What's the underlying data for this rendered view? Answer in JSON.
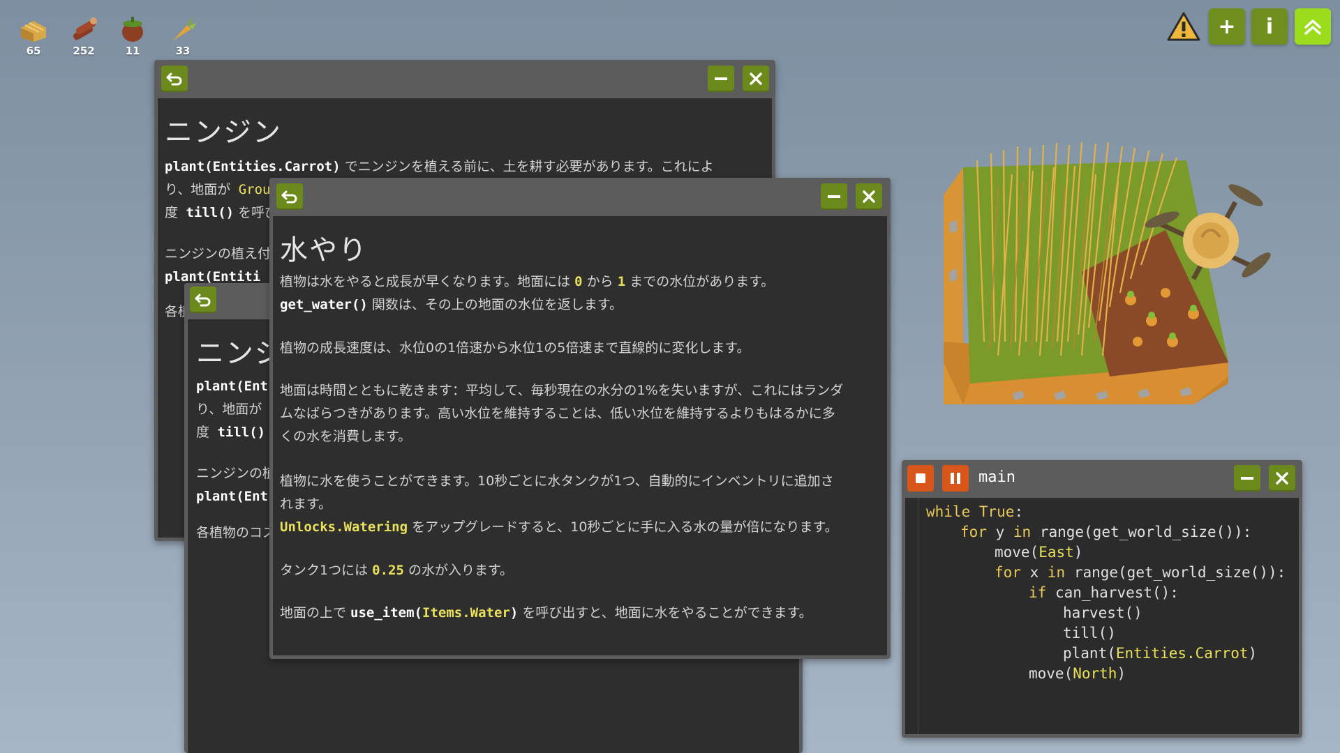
{
  "inventory": [
    {
      "name": "hay",
      "icon": "hay-icon",
      "count": "65"
    },
    {
      "name": "wood",
      "icon": "wood-icon",
      "count": "252"
    },
    {
      "name": "pumpkin",
      "icon": "pumpkin-icon",
      "count": "11"
    },
    {
      "name": "carrot",
      "icon": "carrot-icon",
      "count": "33"
    }
  ],
  "top_buttons": {
    "warning_icon": "warning-icon",
    "add_label": "+",
    "info_label": "i",
    "upgrade_icon": "double-chevron-up-icon"
  },
  "carrot_window": {
    "title": "ニンジン",
    "line1_code": "plant(Entities.Carrot)",
    "line1_text": " でニンジンを植える前に、土を耕す必要があります。これによ",
    "line2_text": "り、地面が",
    "line2_code": " Grou",
    "line3_text": "度",
    "line3_code": " till()",
    "line3_text2": " を呼び",
    "line4_text": "ニンジンの植え付",
    "line5_code": "plant(Entiti",
    "line6_text": "各植"
  },
  "carrot_window_back": {
    "title": "ニンジ",
    "line1_code": "plant(Ent",
    "line2_text": "り、地面が",
    "line3_text": "度",
    "line3_code": " till()",
    "line4_text": "ニンジンの植",
    "line5_code": "plant(Ent",
    "line6_text": "各植物のコス"
  },
  "water_window": {
    "title": "水やり",
    "p1_a": "植物は水をやると成長が早くなります。地面には ",
    "p1_b": "0",
    "p1_c": " から ",
    "p1_d": "1",
    "p1_e": " までの水位があります。",
    "p1_code": "get_water()",
    "p1_f": " 関数は、その上の地面の水位を返します。",
    "p2": "植物の成長速度は、水位0の1倍速から水位1の5倍速まで直線的に変化します。",
    "p3_l1": "地面は時間とともに乾きます：平均して、毎秒現在の水分の1%を失いますが、これにはランダ",
    "p3_l2": "ムなばらつきがあります。高い水位を維持することは、低い水位を維持するよりもはるかに多",
    "p3_l3": "くの水を消費します。",
    "p4_l1": "植物に水を使うことができます。10秒ごとに水タンクが1つ、自動的にインベントリに追加さ",
    "p4_l2": "れます。",
    "p4_code": "Unlocks.Watering",
    "p4_l3": " をアップグレードすると、10秒ごとに手に入る水の量が倍になります。",
    "p5_a": "タンク1つには ",
    "p5_b": "0.25",
    "p5_c": " の水が入ります。",
    "p6_a": "地面の上で ",
    "p6_code1": "use_item(",
    "p6_code2": "Items.Water",
    "p6_code3": ")",
    "p6_b": " を呼び出すと、地面に水をやることができます。"
  },
  "code_window": {
    "title": "main",
    "lines": [
      {
        "indent": 0,
        "tokens": [
          {
            "t": "while ",
            "c": "kw"
          },
          {
            "t": "True",
            "c": "kw"
          },
          {
            "t": ":",
            "c": ""
          }
        ]
      },
      {
        "indent": 1,
        "tokens": [
          {
            "t": "for ",
            "c": "kw"
          },
          {
            "t": "y ",
            "c": ""
          },
          {
            "t": "in ",
            "c": "kw"
          },
          {
            "t": "range(get_world_size()):",
            "c": ""
          }
        ]
      },
      {
        "indent": 2,
        "tokens": [
          {
            "t": "move(",
            "c": ""
          },
          {
            "t": "East",
            "c": "gy"
          },
          {
            "t": ")",
            "c": ""
          }
        ]
      },
      {
        "indent": 2,
        "tokens": [
          {
            "t": "for ",
            "c": "kw"
          },
          {
            "t": "x ",
            "c": ""
          },
          {
            "t": "in ",
            "c": "kw"
          },
          {
            "t": "range(get_world_size()):",
            "c": ""
          }
        ]
      },
      {
        "indent": 3,
        "tokens": [
          {
            "t": "if ",
            "c": "kw"
          },
          {
            "t": "can_harvest():",
            "c": ""
          }
        ]
      },
      {
        "indent": 4,
        "tokens": [
          {
            "t": "harvest()",
            "c": ""
          }
        ]
      },
      {
        "indent": 4,
        "tokens": [
          {
            "t": "till()",
            "c": ""
          }
        ]
      },
      {
        "indent": 4,
        "tokens": [
          {
            "t": "plant(",
            "c": ""
          },
          {
            "t": "Entities.Carrot",
            "c": "gy"
          },
          {
            "t": ")",
            "c": ""
          }
        ]
      },
      {
        "indent": 3,
        "tokens": [
          {
            "t": "move(",
            "c": ""
          },
          {
            "t": "North",
            "c": "gy"
          },
          {
            "t": ")",
            "c": ""
          }
        ]
      }
    ]
  },
  "icons": {
    "back": "back-arrow-icon",
    "minimize": "minimize-icon",
    "close": "close-icon",
    "stop": "stop-icon",
    "pause": "pause-icon"
  },
  "colors": {
    "button_green": "#6b8a1b",
    "button_bright_green": "#9bdc1c",
    "stop_orange": "#d8561a",
    "code_yellow": "#e9e15a",
    "panel_dark": "#2e2e2e",
    "titlebar_gray": "#5c5c5c"
  }
}
